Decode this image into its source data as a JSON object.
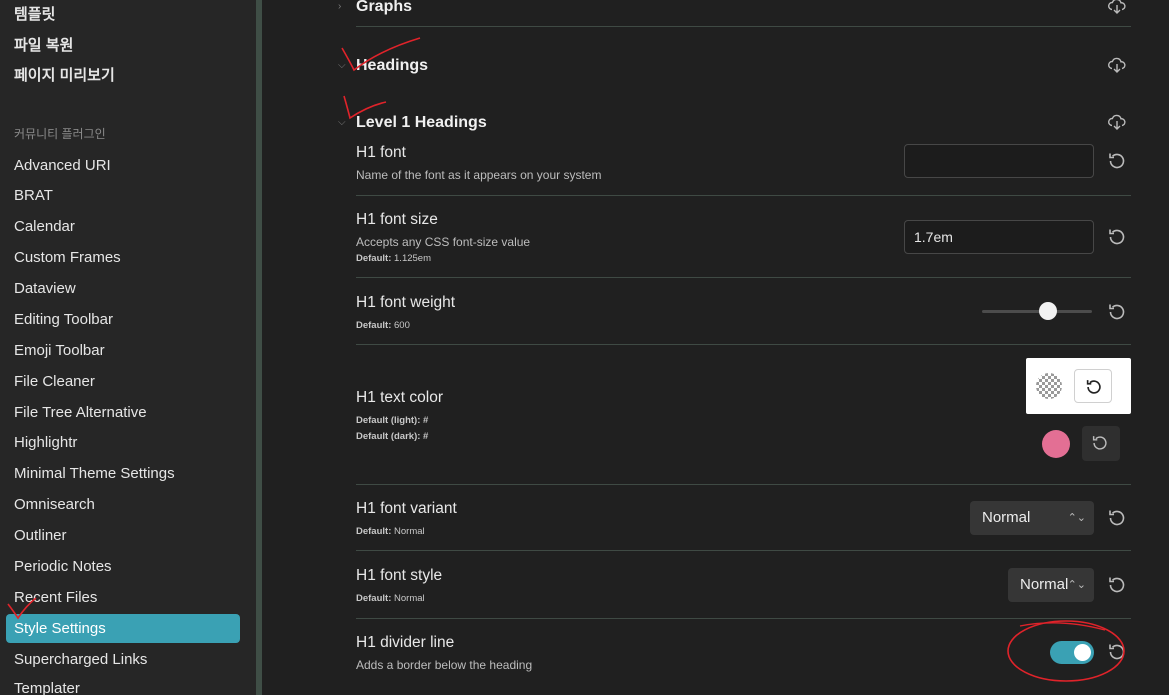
{
  "sidebar": {
    "korean_items": [
      "템플릿",
      "파일 복원",
      "페이지 미리보기"
    ],
    "section_title": "커뮤니티 플러그인",
    "plugins": [
      "Advanced URI",
      "BRAT",
      "Calendar",
      "Custom Frames",
      "Dataview",
      "Editing Toolbar",
      "Emoji Toolbar",
      "File Cleaner",
      "File Tree Alternative",
      "Highlightr",
      "Minimal Theme Settings",
      "Omnisearch",
      "Outliner",
      "Periodic Notes",
      "Recent Files",
      "Style Settings",
      "Supercharged Links",
      "Templater"
    ],
    "active_plugin": "Style Settings"
  },
  "headers": {
    "graphs": "Graphs",
    "headings": "Headings",
    "level1": "Level 1 Headings"
  },
  "settings": {
    "h1_font": {
      "title": "H1 font",
      "desc": "Name of the font as it appears on your system",
      "value": ""
    },
    "h1_font_size": {
      "title": "H1 font size",
      "desc": "Accepts any CSS font-size value",
      "default_label": "Default:",
      "default_value": "1.125em",
      "value": "1.7em"
    },
    "h1_font_weight": {
      "title": "H1 font weight",
      "default_label": "Default:",
      "default_value": "600",
      "slider_fraction": 0.6
    },
    "h1_text_color": {
      "title": "H1 text color",
      "default_light": "Default (light): #",
      "default_dark": "Default (dark): #",
      "dark_color": "#e36f94"
    },
    "h1_font_variant": {
      "title": "H1 font variant",
      "default_label": "Default:",
      "default_value": "Normal",
      "value": "Normal"
    },
    "h1_font_style": {
      "title": "H1 font style",
      "default_label": "Default:",
      "default_value": "Normal",
      "value": "Normal"
    },
    "h1_divider_line": {
      "title": "H1 divider line",
      "desc": "Adds a border below the heading",
      "enabled": true
    }
  },
  "colors": {
    "accent": "#3aa1b4",
    "background": "#202020",
    "sidebar": "#262626"
  }
}
